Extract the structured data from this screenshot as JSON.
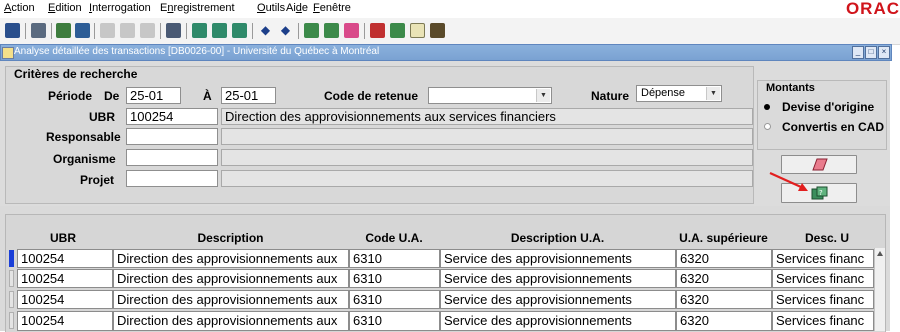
{
  "menu": {
    "items": [
      {
        "pre": "",
        "u": "A",
        "post": "ction"
      },
      {
        "pre": "",
        "u": "E",
        "post": "dition"
      },
      {
        "pre": "",
        "u": "I",
        "post": "nterrogation"
      },
      {
        "pre": "E",
        "u": "n",
        "post": "registrement"
      },
      {
        "pre": "",
        "u": "O",
        "post": "utils"
      },
      {
        "pre": "Ai",
        "u": "d",
        "post": "e"
      },
      {
        "pre": "",
        "u": "F",
        "post": "enêtre"
      }
    ],
    "logo": "ORAC"
  },
  "window": {
    "title": "Analyse détaillée des transactions [DB0026-00] - Université du Québec à Montréal",
    "buttons": [
      "_",
      "□",
      "×"
    ]
  },
  "criteria": {
    "title": "Critères de recherche",
    "periode_label": "Période",
    "de_label": "De",
    "de_value": "25-01",
    "a_label": "À",
    "a_value": "25-01",
    "code_retenue_label": "Code de retenue",
    "code_retenue_value": "",
    "nature_label": "Nature",
    "nature_value": "Dépense",
    "ubr_label": "UBR",
    "ubr_value": "100254",
    "ubr_desc": "Direction des approvisionnements aux services financiers",
    "responsable_label": "Responsable",
    "responsable_value": "",
    "organisme_label": "Organisme",
    "organisme_value": "",
    "projet_label": "Projet",
    "projet_value": ""
  },
  "montants": {
    "title": "Montants",
    "option1": "Devise d'origine",
    "option2": "Convertis en CAD",
    "selected": "Devise d'origine"
  },
  "grid": {
    "headers": [
      "UBR",
      "Description",
      "Code U.A.",
      "Description U.A.",
      "U.A. supérieure",
      "Desc. U"
    ],
    "rows": [
      [
        "100254",
        "Direction des approvisionnements aux",
        "6310",
        "Service des approvisionnements",
        "6320",
        "Services financ"
      ],
      [
        "100254",
        "Direction des approvisionnements aux",
        "6310",
        "Service des approvisionnements",
        "6320",
        "Services financ"
      ],
      [
        "100254",
        "Direction des approvisionnements aux",
        "6310",
        "Service des approvisionnements",
        "6320",
        "Services financ"
      ],
      [
        "100254",
        "Direction des approvisionnements aux",
        "6310",
        "Service des approvisionnements",
        "6320",
        "Services financ"
      ]
    ]
  },
  "colors": {
    "accent_red": "#d0141b",
    "title_bar": "#7aa2d2",
    "current_row": "#1a3fd8"
  }
}
